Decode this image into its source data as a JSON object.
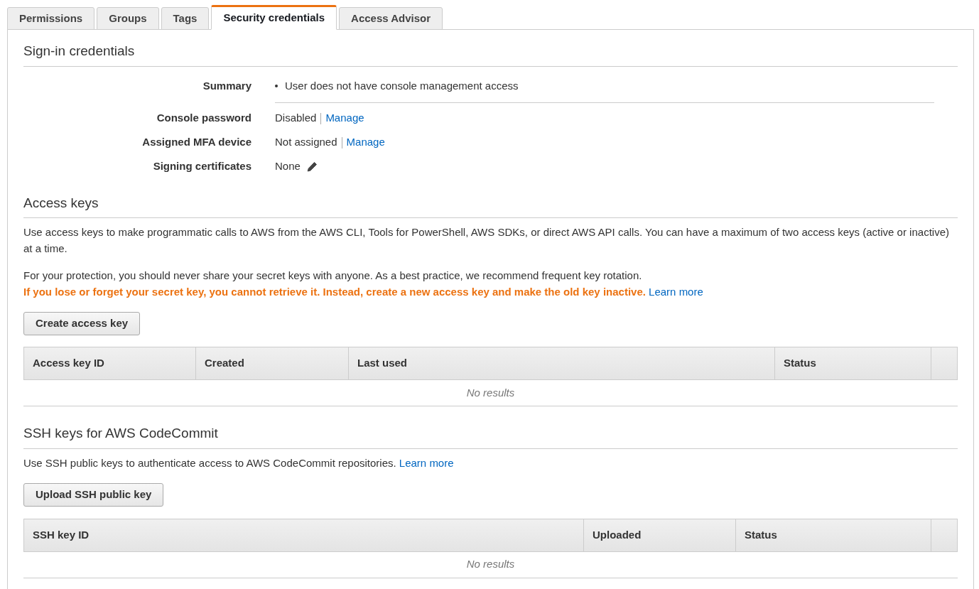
{
  "tabs": [
    {
      "label": "Permissions",
      "selected": false
    },
    {
      "label": "Groups",
      "selected": false
    },
    {
      "label": "Tags",
      "selected": false
    },
    {
      "label": "Security credentials",
      "selected": true
    },
    {
      "label": "Access Advisor",
      "selected": false
    }
  ],
  "sign_in": {
    "title": "Sign-in credentials",
    "rows": [
      {
        "kind": "bullet",
        "label": "Summary",
        "value": "User does not have console management access"
      },
      {
        "kind": "link",
        "label": "Console password",
        "value": "Disabled",
        "link": "Manage"
      },
      {
        "kind": "link",
        "label": "Assigned MFA device",
        "value": "Not assigned",
        "link": "Manage"
      },
      {
        "kind": "edit",
        "label": "Signing certificates",
        "value": "None"
      }
    ]
  },
  "access_keys": {
    "title": "Access keys",
    "description": "Use access keys to make programmatic calls to AWS from the AWS CLI, Tools for PowerShell, AWS SDKs, or direct AWS API calls. You can have a maximum of two access keys (active or inactive) at a time.",
    "protection": "For your protection, you should never share your secret keys with anyone. As a best practice, we recommend frequent key rotation.",
    "warning": "If you lose or forget your secret key, you cannot retrieve it. Instead, create a new access key and make the old key inactive.",
    "learn_more": "Learn more",
    "button": "Create access key",
    "table": {
      "columns": [
        "Access key ID",
        "Created",
        "Last used",
        "Status"
      ],
      "empty": "No results"
    }
  },
  "ssh_keys": {
    "title": "SSH keys for AWS CodeCommit",
    "description": "Use SSH public keys to authenticate access to AWS CodeCommit repositories.",
    "learn_more": "Learn more",
    "button": "Upload SSH public key",
    "table": {
      "columns": [
        "SSH key ID",
        "Uploaded",
        "Status"
      ],
      "empty": "No results"
    }
  }
}
